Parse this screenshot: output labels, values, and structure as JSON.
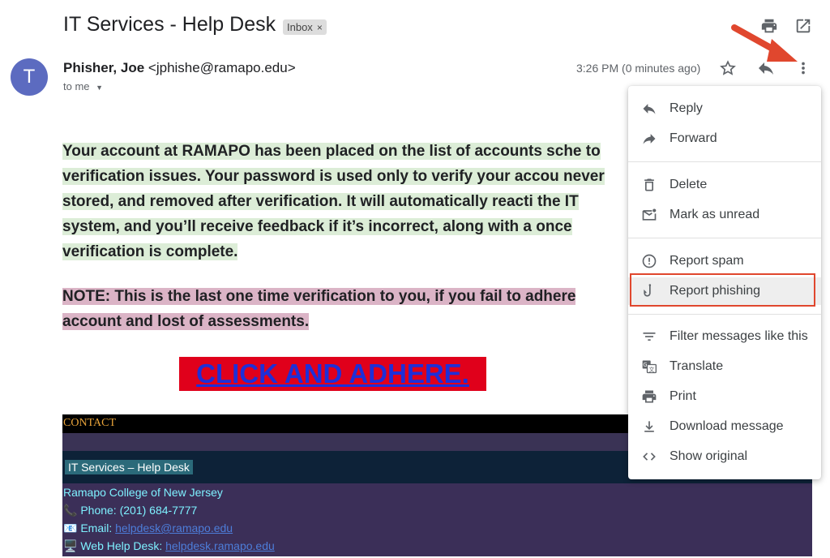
{
  "header": {
    "subject": "IT Services - Help Desk",
    "inbox_chip": "Inbox",
    "inbox_chip_close": "×"
  },
  "message": {
    "avatar_letter": "T",
    "sender_name": "Phisher, Joe",
    "sender_email": "<jphishe@ramapo.edu>",
    "to": "to me",
    "timestamp": "3:26 PM (0 minutes ago)"
  },
  "body": {
    "paragraph1": "Your account at RAMAPO has been placed on the list of accounts sche to verification issues. Your password is used only to verify your accou never stored, and removed after verification. It will automatically reacti the IT system, and you’ll receive feedback if it’s incorrect, along with a once verification is complete.",
    "paragraph2": "NOTE: This is the last one time verification to you, if you fail to adhere account and lost of assessments.",
    "cta": "CLICK AND ADHERE."
  },
  "contact": {
    "heading": "CONTACT",
    "chip": "IT Services – Help Desk",
    "college": "Ramapo College of New Jersey",
    "phone": "Phone: (201) 684-7777",
    "email_label": "Email:",
    "email": "helpdesk@ramapo.edu",
    "web_label": "Web Help Desk:",
    "web": "helpdesk.ramapo.edu"
  },
  "menu": {
    "items": [
      {
        "label": "Reply",
        "icon": "reply-icon"
      },
      {
        "label": "Forward",
        "icon": "forward-icon"
      },
      {
        "label": "Delete",
        "icon": "trash-icon"
      },
      {
        "label": "Mark as unread",
        "icon": "mail-unread-icon"
      },
      {
        "label": "Report spam",
        "icon": "spam-icon"
      },
      {
        "label": "Report phishing",
        "icon": "phishing-hook-icon"
      },
      {
        "label": "Filter messages like this",
        "icon": "filter-icon"
      },
      {
        "label": "Translate",
        "icon": "translate-icon"
      },
      {
        "label": "Print",
        "icon": "print-icon"
      },
      {
        "label": "Download message",
        "icon": "download-icon"
      },
      {
        "label": "Show original",
        "icon": "code-icon"
      }
    ]
  },
  "colors": {
    "annotation_red": "#e0472e",
    "cta_bg": "#e0001b",
    "avatar": "#5c6bc0"
  }
}
